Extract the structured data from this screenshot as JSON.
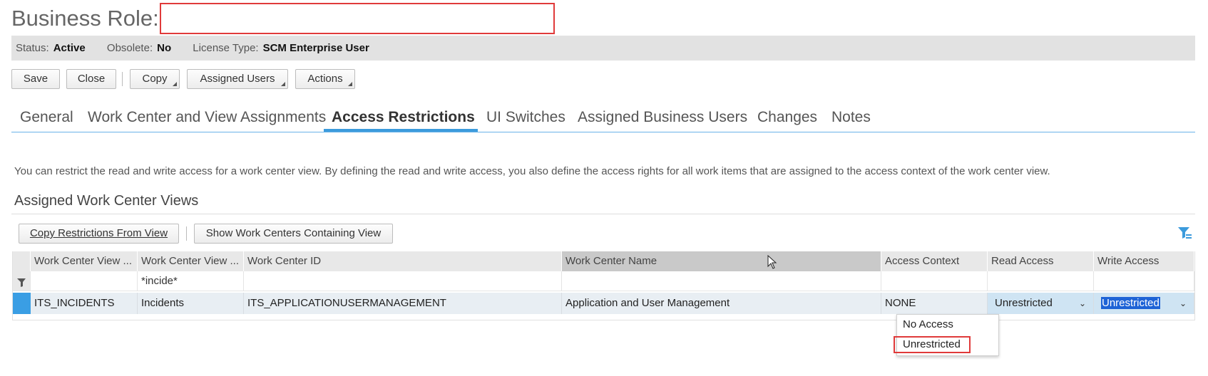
{
  "page": {
    "title": "Business Role:",
    "title_input_value": ""
  },
  "status": {
    "status_label": "Status:",
    "status_value": "Active",
    "obsolete_label": "Obsolete:",
    "obsolete_value": "No",
    "license_label": "License Type:",
    "license_value": "SCM Enterprise User"
  },
  "toolbar": {
    "save": "Save",
    "close": "Close",
    "copy": "Copy",
    "assigned_users": "Assigned Users",
    "actions": "Actions"
  },
  "tabs": [
    {
      "label": "General"
    },
    {
      "label": "Work Center and View Assignments"
    },
    {
      "label": "Access Restrictions",
      "active": true
    },
    {
      "label": "UI Switches"
    },
    {
      "label": "Assigned Business Users"
    },
    {
      "label": "Changes"
    },
    {
      "label": "Notes"
    }
  ],
  "description": "You can restrict the read and write access for a work center view. By defining the read and write access, you also define the access rights for all work items that are assigned to the access context of the work center view.",
  "section": {
    "title": "Assigned Work Center Views",
    "copy_btn": "Copy Restrictions From View",
    "show_btn": "Show Work Centers Containing View"
  },
  "table": {
    "columns": [
      "Work Center View ...",
      "Work Center View ...",
      "Work Center ID",
      "Work Center Name",
      "Access Context",
      "Read Access",
      "Write Access"
    ],
    "filters": [
      "",
      "*incide*",
      "",
      "",
      "",
      "",
      ""
    ],
    "rows": [
      [
        "ITS_INCIDENTS",
        "Incidents",
        "ITS_APPLICATIONUSERMANAGEMENT",
        "Application and User Management",
        "NONE",
        "Unrestricted",
        "Unrestricted"
      ]
    ]
  },
  "dropdown": {
    "options": [
      "No Access",
      "Unrestricted"
    ],
    "selected": "Unrestricted"
  },
  "colors": {
    "accent": "#3c9bdc",
    "highlight_red": "#e03a3a",
    "row_selected": "#3a9ee4"
  }
}
